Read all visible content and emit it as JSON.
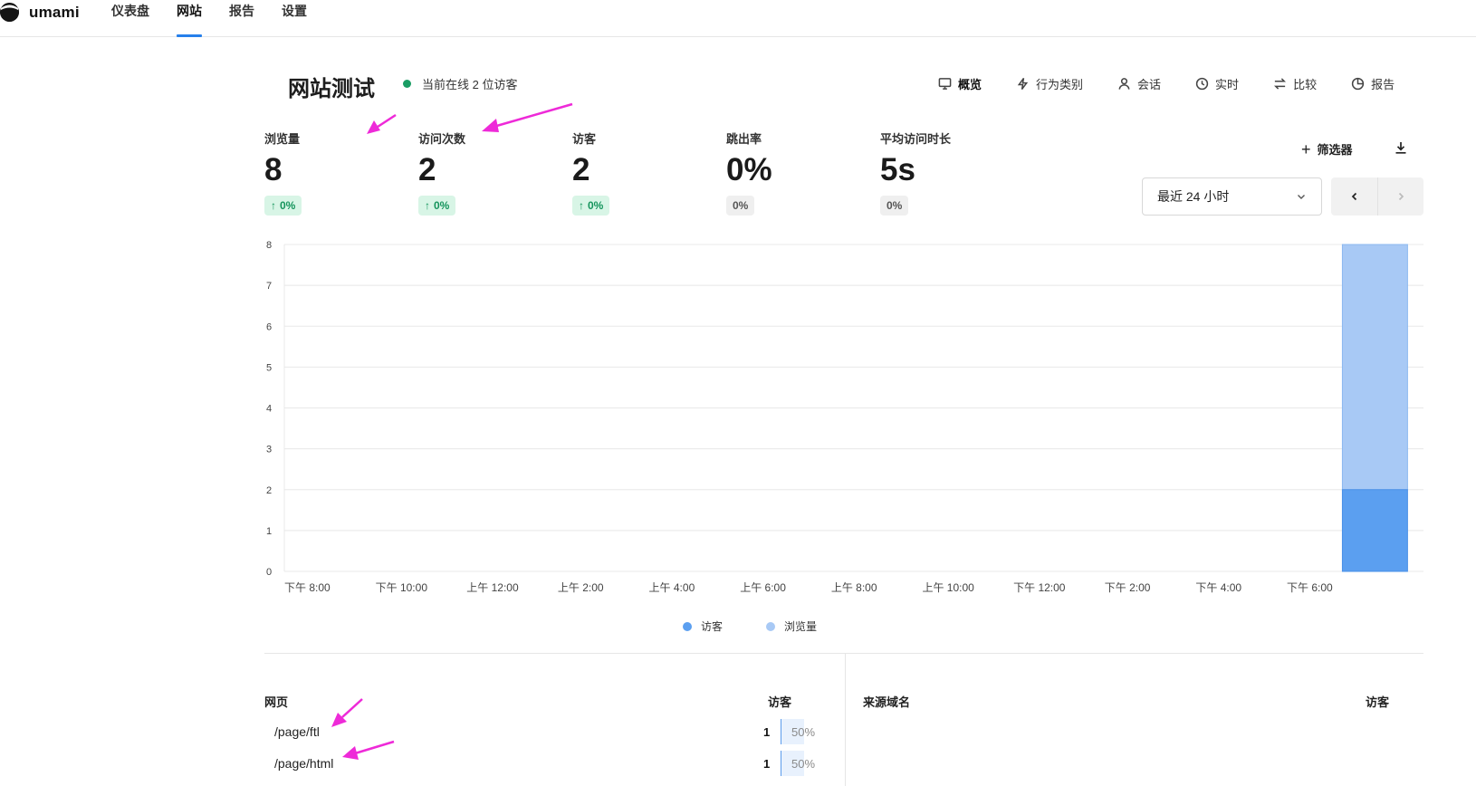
{
  "app": {
    "name": "umami"
  },
  "nav": {
    "items": [
      "仪表盘",
      "网站",
      "报告",
      "设置"
    ],
    "active": "网站"
  },
  "header": {
    "title": "网站测试",
    "online_text": "当前在线 2 位访客"
  },
  "tabs": [
    {
      "label": "概览",
      "icon": "monitor-icon",
      "active": true
    },
    {
      "label": "行为类别",
      "icon": "bolt-icon",
      "active": false
    },
    {
      "label": "会话",
      "icon": "user-icon",
      "active": false
    },
    {
      "label": "实时",
      "icon": "clock-icon",
      "active": false
    },
    {
      "label": "比较",
      "icon": "swap-icon",
      "active": false
    },
    {
      "label": "报告",
      "icon": "pie-icon",
      "active": false
    }
  ],
  "metrics": [
    {
      "label": "浏览量",
      "value": "8",
      "change": "0%",
      "trend": "up"
    },
    {
      "label": "访问次数",
      "value": "2",
      "change": "0%",
      "trend": "up"
    },
    {
      "label": "访客",
      "value": "2",
      "change": "0%",
      "trend": "up"
    },
    {
      "label": "跳出率",
      "value": "0%",
      "change": "0%",
      "trend": "flat"
    },
    {
      "label": "平均访问时长",
      "value": "5s",
      "change": "0%",
      "trend": "flat"
    }
  ],
  "controls": {
    "filter_label": "筛选器",
    "date_range": "最近 24 小时"
  },
  "colors": {
    "accent": "#2680eb",
    "visitors": "#5b9ff0",
    "views": "#a8c9f5",
    "up_badge_bg": "#d8f5e6",
    "up_badge_text": "#15945c",
    "annotation": "#ee2ad8"
  },
  "chart_data": {
    "type": "bar",
    "stacked": true,
    "categories": [
      "下午 8:00",
      "下午 10:00",
      "上午 12:00",
      "上午 2:00",
      "上午 4:00",
      "上午 6:00",
      "上午 8:00",
      "上午 10:00",
      "下午 12:00",
      "下午 2:00",
      "下午 4:00",
      "下午 6:00"
    ],
    "series": [
      {
        "name": "访客",
        "bar_index": 23,
        "value": 2
      },
      {
        "name": "浏览量",
        "bar_index": 23,
        "value": 8
      }
    ],
    "bar_slots": 25,
    "ylim": [
      0,
      8
    ],
    "yticks": [
      0,
      1,
      2,
      3,
      4,
      5,
      6,
      7,
      8
    ],
    "grid": true,
    "legend_position": "bottom"
  },
  "tables": {
    "pages": {
      "title": "网页",
      "metric_label": "访客",
      "rows": [
        {
          "path": "/page/ftl",
          "count": "1",
          "pct": "50%"
        },
        {
          "path": "/page/html",
          "count": "1",
          "pct": "50%"
        }
      ]
    },
    "referrers": {
      "title": "来源域名",
      "metric_label": "访客"
    }
  }
}
